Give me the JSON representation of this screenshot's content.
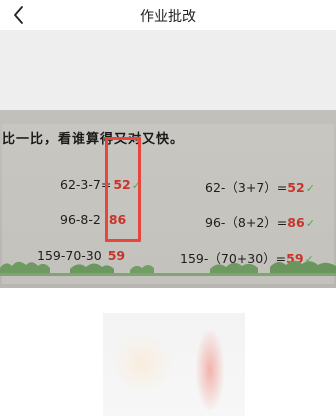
{
  "nav": {
    "title": "作业批改",
    "back_icon": "chevron-left-icon"
  },
  "photo": {
    "instruction": "比一比，看谁算得又对又快。",
    "rows": [
      {
        "left_expr": "62-3-7=",
        "left_answer": "52",
        "right_expr": "62-（3+7）=",
        "right_answer": "52"
      },
      {
        "left_expr": "96-8-2",
        "left_answer": "86",
        "right_expr": "96-（8+2）=",
        "right_answer": "86"
      },
      {
        "left_expr": "159-70-30",
        "left_answer": "59",
        "right_expr": "159-（70+30）=",
        "right_answer": "59"
      }
    ],
    "check_mark": "✓",
    "colors": {
      "answer": "#c8342a",
      "check": "#4caf50",
      "highlight_box": "#e8453d"
    }
  }
}
